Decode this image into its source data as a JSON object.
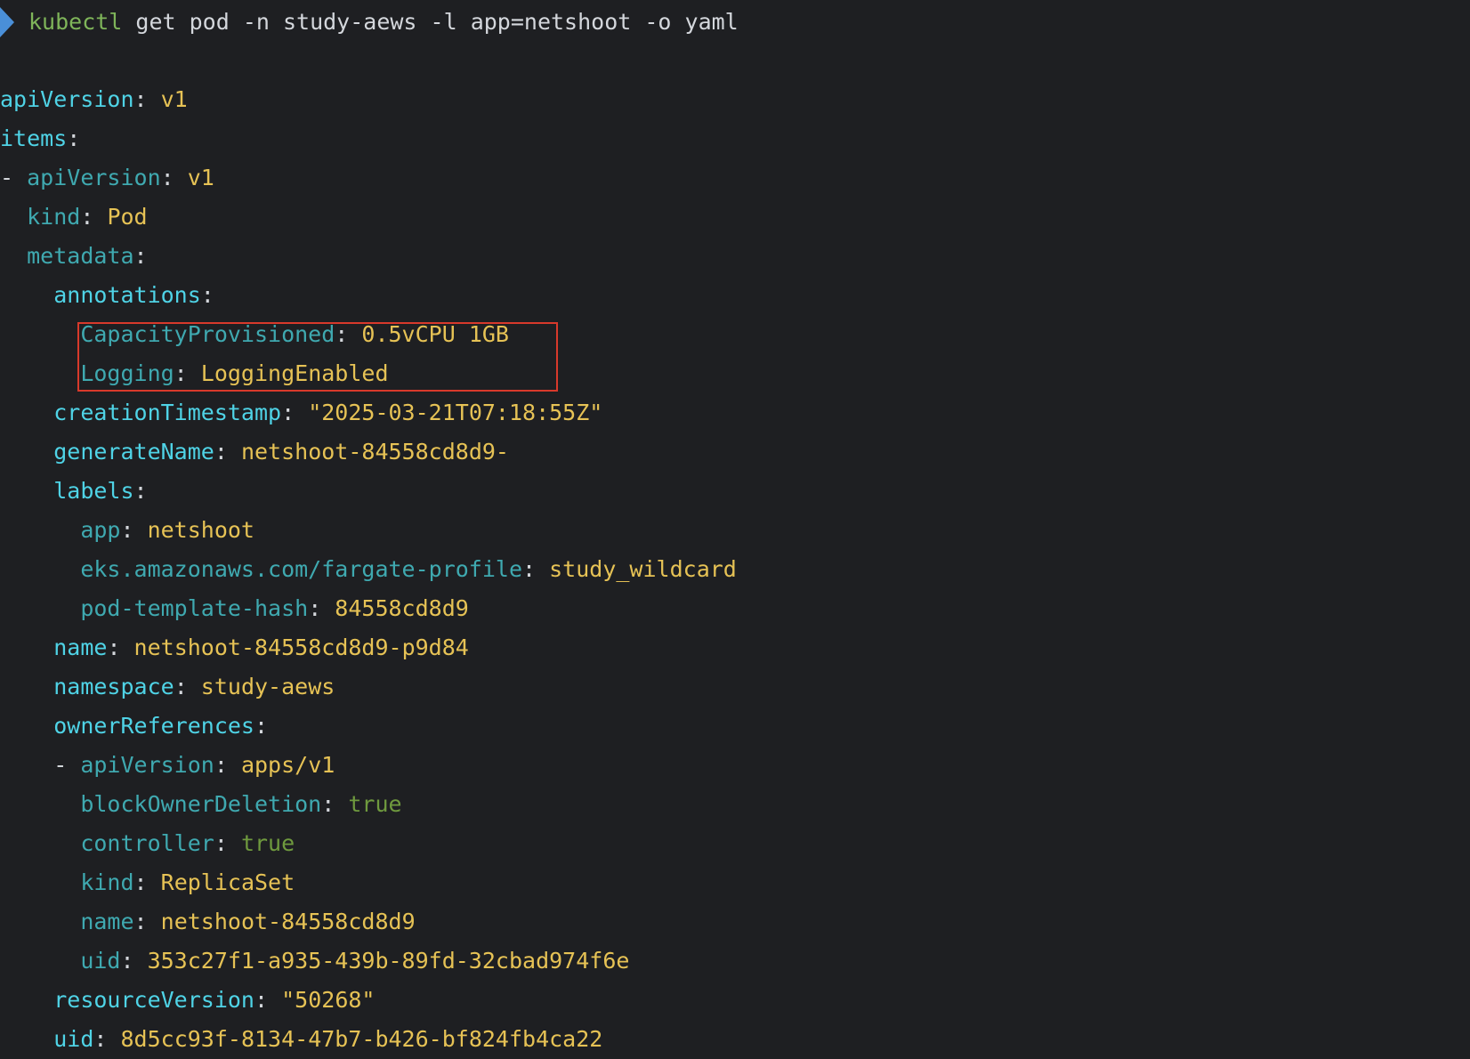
{
  "prompt": {
    "icon": "prompt-arrow-icon",
    "command": "kubectl",
    "args": " get pod -n study-aews -l app=netshoot -o yaml"
  },
  "yaml": [
    {
      "indent": "",
      "dash": "",
      "key": "apiVersion",
      "sep": ": ",
      "value": "v1",
      "key_level": "k1",
      "value_kind": "val"
    },
    {
      "indent": "",
      "dash": "",
      "key": "items",
      "sep": ":",
      "value": "",
      "key_level": "k1",
      "value_kind": "val"
    },
    {
      "indent": "",
      "dash": "- ",
      "key": "apiVersion",
      "sep": ": ",
      "value": "v1",
      "key_level": "k2",
      "value_kind": "val"
    },
    {
      "indent": "  ",
      "dash": "",
      "key": "kind",
      "sep": ": ",
      "value": "Pod",
      "key_level": "k2",
      "value_kind": "val"
    },
    {
      "indent": "  ",
      "dash": "",
      "key": "metadata",
      "sep": ":",
      "value": "",
      "key_level": "k2",
      "value_kind": "val"
    },
    {
      "indent": "    ",
      "dash": "",
      "key": "annotations",
      "sep": ":",
      "value": "",
      "key_level": "k1",
      "value_kind": "val"
    },
    {
      "indent": "      ",
      "dash": "",
      "key": "CapacityProvisioned",
      "sep": ": ",
      "value": "0.5vCPU 1GB",
      "key_level": "k2",
      "value_kind": "val"
    },
    {
      "indent": "      ",
      "dash": "",
      "key": "Logging",
      "sep": ": ",
      "value": "LoggingEnabled",
      "key_level": "k2",
      "value_kind": "val"
    },
    {
      "indent": "    ",
      "dash": "",
      "key": "creationTimestamp",
      "sep": ": ",
      "value": "\"2025-03-21T07:18:55Z\"",
      "key_level": "k1",
      "value_kind": "val"
    },
    {
      "indent": "    ",
      "dash": "",
      "key": "generateName",
      "sep": ": ",
      "value": "netshoot-84558cd8d9-",
      "key_level": "k1",
      "value_kind": "val"
    },
    {
      "indent": "    ",
      "dash": "",
      "key": "labels",
      "sep": ":",
      "value": "",
      "key_level": "k1",
      "value_kind": "val"
    },
    {
      "indent": "      ",
      "dash": "",
      "key": "app",
      "sep": ": ",
      "value": "netshoot",
      "key_level": "k2",
      "value_kind": "val"
    },
    {
      "indent": "      ",
      "dash": "",
      "key": "eks.amazonaws.com/fargate-profile",
      "sep": ": ",
      "value": "study_wildcard",
      "key_level": "k2",
      "value_kind": "val"
    },
    {
      "indent": "      ",
      "dash": "",
      "key": "pod-template-hash",
      "sep": ": ",
      "value": "84558cd8d9",
      "key_level": "k2",
      "value_kind": "val"
    },
    {
      "indent": "    ",
      "dash": "",
      "key": "name",
      "sep": ": ",
      "value": "netshoot-84558cd8d9-p9d84",
      "key_level": "k1",
      "value_kind": "val"
    },
    {
      "indent": "    ",
      "dash": "",
      "key": "namespace",
      "sep": ": ",
      "value": "study-aews",
      "key_level": "k1",
      "value_kind": "val"
    },
    {
      "indent": "    ",
      "dash": "",
      "key": "ownerReferences",
      "sep": ":",
      "value": "",
      "key_level": "k1",
      "value_kind": "val"
    },
    {
      "indent": "    ",
      "dash": "- ",
      "key": "apiVersion",
      "sep": ": ",
      "value": "apps/v1",
      "key_level": "k2",
      "value_kind": "val"
    },
    {
      "indent": "      ",
      "dash": "",
      "key": "blockOwnerDeletion",
      "sep": ": ",
      "value": "true",
      "key_level": "k2",
      "value_kind": "bool"
    },
    {
      "indent": "      ",
      "dash": "",
      "key": "controller",
      "sep": ": ",
      "value": "true",
      "key_level": "k2",
      "value_kind": "bool"
    },
    {
      "indent": "      ",
      "dash": "",
      "key": "kind",
      "sep": ": ",
      "value": "ReplicaSet",
      "key_level": "k2",
      "value_kind": "val"
    },
    {
      "indent": "      ",
      "dash": "",
      "key": "name",
      "sep": ": ",
      "value": "netshoot-84558cd8d9",
      "key_level": "k2",
      "value_kind": "val"
    },
    {
      "indent": "      ",
      "dash": "",
      "key": "uid",
      "sep": ": ",
      "value": "353c27f1-a935-439b-89fd-32cbad974f6e",
      "key_level": "k2",
      "value_kind": "val"
    },
    {
      "indent": "    ",
      "dash": "",
      "key": "resourceVersion",
      "sep": ": ",
      "value": "\"50268\"",
      "key_level": "k1",
      "value_kind": "val"
    },
    {
      "indent": "    ",
      "dash": "",
      "key": "uid",
      "sep": ": ",
      "value": "8d5cc93f-8134-47b7-b426-bf824fb4ca22",
      "key_level": "k1",
      "value_kind": "val"
    }
  ],
  "colors": {
    "background": "#1e1f22",
    "prompt_arrow": "#4a8fd8",
    "command": "#7fb55a",
    "key_primary": "#4fd3e6",
    "key_nested": "#3fa9b0",
    "value": "#e6c255",
    "boolean": "#6f9a3e",
    "highlight_border": "#d8392b"
  }
}
